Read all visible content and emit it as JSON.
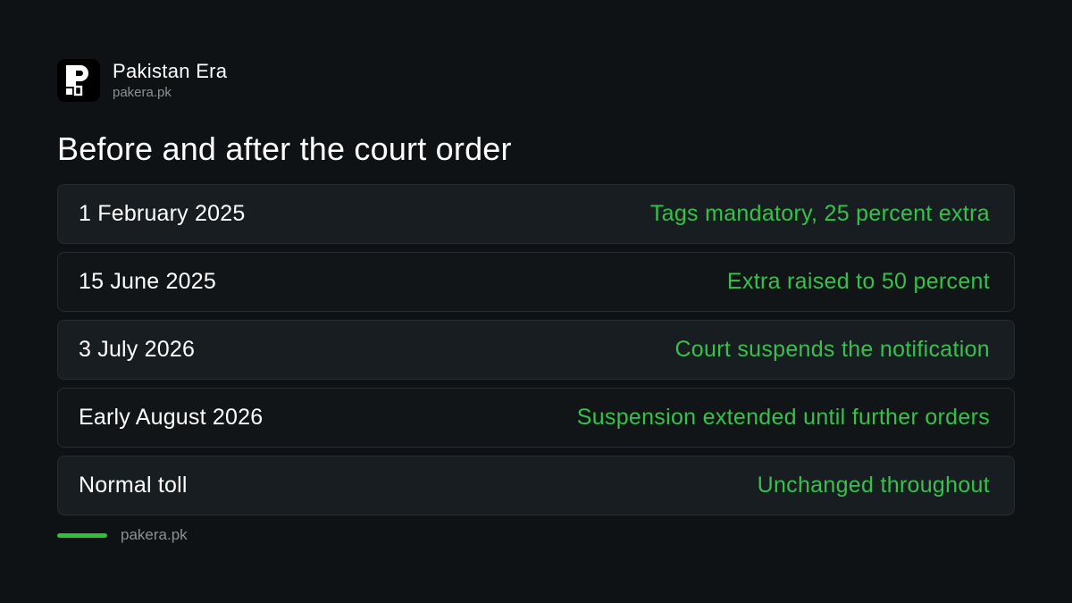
{
  "brand": {
    "name": "Pakistan Era",
    "url": "pakera.pk",
    "logo_icon": "pakera-p-logo-icon"
  },
  "headline": "Before and after the court order",
  "rows": [
    {
      "date": "1 February 2025",
      "event": "Tags mandatory, 25 percent extra"
    },
    {
      "date": "15 June 2025",
      "event": "Extra raised to 50 percent"
    },
    {
      "date": "3 July 2026",
      "event": "Court suspends the notification"
    },
    {
      "date": "Early August 2026",
      "event": "Suspension extended until further orders"
    },
    {
      "date": "Normal toll",
      "event": "Unchanged throughout"
    }
  ],
  "footer": {
    "url": "pakera.pk"
  },
  "colors": {
    "background": "#0f1214",
    "accent_green": "#36c24a",
    "row_shade": "#181d21",
    "row_plain": "#111518"
  }
}
